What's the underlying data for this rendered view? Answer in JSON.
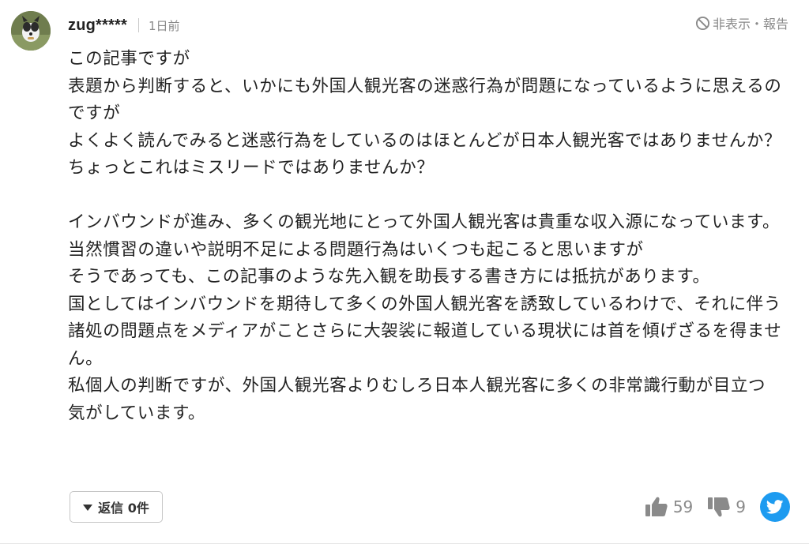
{
  "comment": {
    "username": "zug*****",
    "time": "1日前",
    "hide_report_label": "非表示・報告",
    "body": "この記事ですが\n表題から判断すると、いかにも外国人観光客の迷惑行為が問題になっているように思えるのですが\nよくよく読んでみると迷惑行為をしているのはほとんどが日本人観光客ではありませんか？\nちょっとこれはミスリードではありませんか？\n\nインバウンドが進み、多くの観光地にとって外国人観光客は貴重な収入源になっています。\n当然慣習の違いや説明不足による問題行為はいくつも起こると思いますが\nそうであっても、この記事のような先入観を助長する書き方には抵抗があります。\n国としてはインバウンドを期待して多くの外国人観光客を誘致しているわけで、それに伴う諸処の問題点をメディアがことさらに大袈裟に報道している現状には首を傾げざるを得ません。\n私個人の判断ですが、外国人観光客よりむしろ日本人観光客に多くの非常識行動が目立つ気がしています。",
    "reply_label": "返信 0件",
    "likes": "59",
    "dislikes": "9"
  },
  "icons": {
    "hide": "no-entry-icon",
    "like": "thumbs-up-icon",
    "dislike": "thumbs-down-icon",
    "share": "twitter-bird-icon",
    "reply": "caret-down-icon"
  },
  "colors": {
    "twitter": "#1d9bf0",
    "muted_text": "#8a8a8a"
  }
}
